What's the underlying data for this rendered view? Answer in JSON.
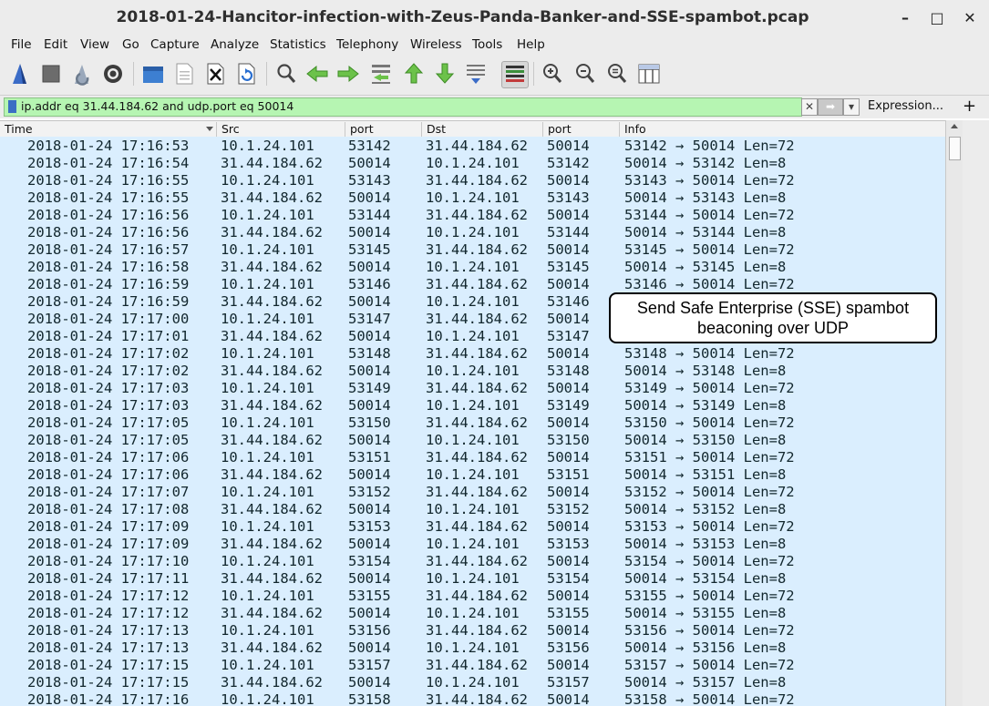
{
  "window": {
    "title": "2018-01-24-Hancitor-infection-with-Zeus-Panda-Banker-and-SSE-spambot.pcap",
    "minimize": "–",
    "maximize": "□",
    "close": "✕"
  },
  "menu": [
    "File",
    "Edit",
    "View",
    "Go",
    "Capture",
    "Analyze",
    "Statistics",
    "Telephony",
    "Wireless",
    "Tools",
    "Help"
  ],
  "toolbar_icons": [
    "shark-fin-start-icon",
    "stop-icon",
    "restart-icon",
    "capture-options-icon",
    "open-folder-icon",
    "save-file-icon",
    "close-file-icon",
    "reload-icon",
    "find-packet-icon",
    "back-arrow-icon",
    "forward-arrow-icon",
    "go-to-packet-icon",
    "first-packet-icon",
    "last-packet-icon",
    "autoscroll-icon",
    "colorize-icon",
    "zoom-in-icon",
    "zoom-out-icon",
    "normal-size-icon",
    "resize-columns-icon"
  ],
  "filter": {
    "value": "ip.addr eq 31.44.184.62 and udp.port eq 50014",
    "clear_glyph": "✕",
    "apply_glyph": "➡",
    "dropdown_glyph": "▾",
    "expression_label": "Expression...",
    "add_label": "+"
  },
  "columns": [
    "Time",
    "Src",
    "port",
    "Dst",
    "port",
    "Info"
  ],
  "rows": [
    [
      "2018-01-24 17:16:53",
      "10.1.24.101",
      "53142",
      "31.44.184.62",
      "50014",
      "53142 → 50014 Len=72"
    ],
    [
      "2018-01-24 17:16:54",
      "31.44.184.62",
      "50014",
      "10.1.24.101",
      "53142",
      "50014 → 53142 Len=8"
    ],
    [
      "2018-01-24 17:16:55",
      "10.1.24.101",
      "53143",
      "31.44.184.62",
      "50014",
      "53143 → 50014 Len=72"
    ],
    [
      "2018-01-24 17:16:55",
      "31.44.184.62",
      "50014",
      "10.1.24.101",
      "53143",
      "50014 → 53143 Len=8"
    ],
    [
      "2018-01-24 17:16:56",
      "10.1.24.101",
      "53144",
      "31.44.184.62",
      "50014",
      "53144 → 50014 Len=72"
    ],
    [
      "2018-01-24 17:16:56",
      "31.44.184.62",
      "50014",
      "10.1.24.101",
      "53144",
      "50014 → 53144 Len=8"
    ],
    [
      "2018-01-24 17:16:57",
      "10.1.24.101",
      "53145",
      "31.44.184.62",
      "50014",
      "53145 → 50014 Len=72"
    ],
    [
      "2018-01-24 17:16:58",
      "31.44.184.62",
      "50014",
      "10.1.24.101",
      "53145",
      "50014 → 53145 Len=8"
    ],
    [
      "2018-01-24 17:16:59",
      "10.1.24.101",
      "53146",
      "31.44.184.62",
      "50014",
      "53146 → 50014 Len=72"
    ],
    [
      "2018-01-24 17:16:59",
      "31.44.184.62",
      "50014",
      "10.1.24.101",
      "53146",
      ""
    ],
    [
      "2018-01-24 17:17:00",
      "10.1.24.101",
      "53147",
      "31.44.184.62",
      "50014",
      ""
    ],
    [
      "2018-01-24 17:17:01",
      "31.44.184.62",
      "50014",
      "10.1.24.101",
      "53147",
      ""
    ],
    [
      "2018-01-24 17:17:02",
      "10.1.24.101",
      "53148",
      "31.44.184.62",
      "50014",
      "53148 → 50014 Len=72"
    ],
    [
      "2018-01-24 17:17:02",
      "31.44.184.62",
      "50014",
      "10.1.24.101",
      "53148",
      "50014 → 53148 Len=8"
    ],
    [
      "2018-01-24 17:17:03",
      "10.1.24.101",
      "53149",
      "31.44.184.62",
      "50014",
      "53149 → 50014 Len=72"
    ],
    [
      "2018-01-24 17:17:03",
      "31.44.184.62",
      "50014",
      "10.1.24.101",
      "53149",
      "50014 → 53149 Len=8"
    ],
    [
      "2018-01-24 17:17:05",
      "10.1.24.101",
      "53150",
      "31.44.184.62",
      "50014",
      "53150 → 50014 Len=72"
    ],
    [
      "2018-01-24 17:17:05",
      "31.44.184.62",
      "50014",
      "10.1.24.101",
      "53150",
      "50014 → 53150 Len=8"
    ],
    [
      "2018-01-24 17:17:06",
      "10.1.24.101",
      "53151",
      "31.44.184.62",
      "50014",
      "53151 → 50014 Len=72"
    ],
    [
      "2018-01-24 17:17:06",
      "31.44.184.62",
      "50014",
      "10.1.24.101",
      "53151",
      "50014 → 53151 Len=8"
    ],
    [
      "2018-01-24 17:17:07",
      "10.1.24.101",
      "53152",
      "31.44.184.62",
      "50014",
      "53152 → 50014 Len=72"
    ],
    [
      "2018-01-24 17:17:08",
      "31.44.184.62",
      "50014",
      "10.1.24.101",
      "53152",
      "50014 → 53152 Len=8"
    ],
    [
      "2018-01-24 17:17:09",
      "10.1.24.101",
      "53153",
      "31.44.184.62",
      "50014",
      "53153 → 50014 Len=72"
    ],
    [
      "2018-01-24 17:17:09",
      "31.44.184.62",
      "50014",
      "10.1.24.101",
      "53153",
      "50014 → 53153 Len=8"
    ],
    [
      "2018-01-24 17:17:10",
      "10.1.24.101",
      "53154",
      "31.44.184.62",
      "50014",
      "53154 → 50014 Len=72"
    ],
    [
      "2018-01-24 17:17:11",
      "31.44.184.62",
      "50014",
      "10.1.24.101",
      "53154",
      "50014 → 53154 Len=8"
    ],
    [
      "2018-01-24 17:17:12",
      "10.1.24.101",
      "53155",
      "31.44.184.62",
      "50014",
      "53155 → 50014 Len=72"
    ],
    [
      "2018-01-24 17:17:12",
      "31.44.184.62",
      "50014",
      "10.1.24.101",
      "53155",
      "50014 → 53155 Len=8"
    ],
    [
      "2018-01-24 17:17:13",
      "10.1.24.101",
      "53156",
      "31.44.184.62",
      "50014",
      "53156 → 50014 Len=72"
    ],
    [
      "2018-01-24 17:17:13",
      "31.44.184.62",
      "50014",
      "10.1.24.101",
      "53156",
      "50014 → 53156 Len=8"
    ],
    [
      "2018-01-24 17:17:15",
      "10.1.24.101",
      "53157",
      "31.44.184.62",
      "50014",
      "53157 → 50014 Len=72"
    ],
    [
      "2018-01-24 17:17:15",
      "31.44.184.62",
      "50014",
      "10.1.24.101",
      "53157",
      "50014 → 53157 Len=8"
    ],
    [
      "2018-01-24 17:17:16",
      "10.1.24.101",
      "53158",
      "31.44.184.62",
      "50014",
      "53158 → 50014 Len=72"
    ]
  ],
  "callout": {
    "line1": "Send Safe Enterprise (SSE) spambot",
    "line2": "beaconing over UDP"
  },
  "colors": {
    "packet_row_bg": "#daeefe",
    "filter_valid_bg": "#b6f5b2",
    "chrome_bg": "#ececec"
  }
}
